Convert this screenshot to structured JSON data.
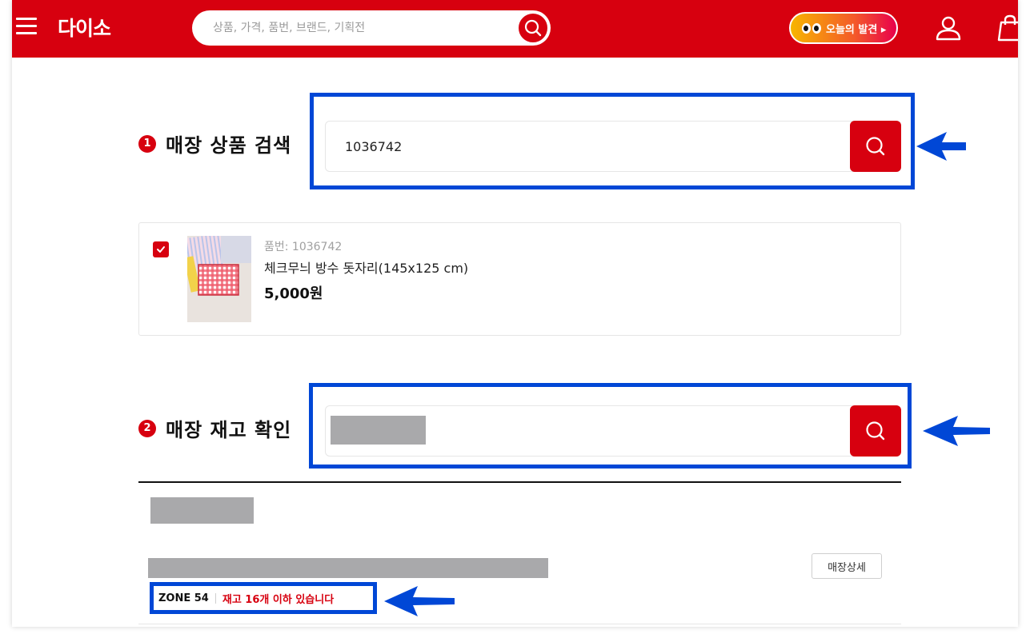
{
  "header": {
    "logo": "다이소",
    "search_placeholder": "상품, 가격, 품번, 브랜드, 기획전",
    "today_badge": "오늘의 발견 ▸"
  },
  "section1": {
    "number": "1",
    "title": "매장 상품 검색",
    "search_value": "1036742"
  },
  "product": {
    "sku": "품번: 1036742",
    "name": "체크무늬 방수 돗자리(145x125 cm)",
    "price": "5,000원",
    "checked": true
  },
  "section2": {
    "number": "2",
    "title": "매장 재고 확인"
  },
  "store_result": {
    "detail_button": "매장상세",
    "zone": "ZONE 54",
    "stock_text": "재고 16개 이하 있습니다"
  },
  "colors": {
    "brand_red": "#d7000f",
    "highlight_blue": "#0047d6",
    "redaction_gray": "#a9a9ab"
  },
  "icons": [
    "menu-icon",
    "search-icon",
    "user-icon",
    "cart-icon",
    "check-icon",
    "arrow-left-icon"
  ]
}
